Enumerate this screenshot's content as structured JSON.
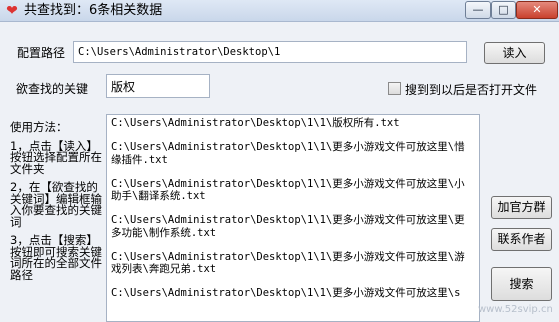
{
  "window": {
    "title": "共查找到：6条相关数据",
    "min_symbol": "—",
    "max_symbol": "□",
    "close_symbol": "✕"
  },
  "config": {
    "path_label": "配置路径",
    "path_value": "C:\\Users\\Administrator\\Desktop\\1",
    "read_button": "读入"
  },
  "search": {
    "keyword_label": "欲查找的关键",
    "keyword_value": "版权",
    "open_after_label": "搜到到以后是否打开文件",
    "open_after_checked": false
  },
  "help": {
    "title": "使用方法：",
    "step1": "1，点击【读入】按钮选择配置所在文件夹",
    "step2": "2，在【欲查找的关键词】编辑框输入你要查找的关键词",
    "step3": "3，点击【搜索】按钮即可搜索关键词所在的全部文件路径"
  },
  "results": [
    "C:\\Users\\Administrator\\Desktop\\1\\1\\版权所有.txt",
    "C:\\Users\\Administrator\\Desktop\\1\\1\\更多小游戏文件可放这里\\惜缘插件.txt",
    "C:\\Users\\Administrator\\Desktop\\1\\1\\更多小游戏文件可放这里\\小助手\\翻译系统.txt",
    "C:\\Users\\Administrator\\Desktop\\1\\1\\更多小游戏文件可放这里\\更多功能\\制作系统.txt",
    "C:\\Users\\Administrator\\Desktop\\1\\1\\更多小游戏文件可放这里\\游戏列表\\奔跑兄弟.txt",
    "C:\\Users\\Administrator\\Desktop\\1\\1\\更多小游戏文件可放这里\\s"
  ],
  "side_buttons": {
    "join_group": "加官方群",
    "contact_author": "联系作者",
    "search": "搜索"
  },
  "watermark": "www.52svip.cn"
}
